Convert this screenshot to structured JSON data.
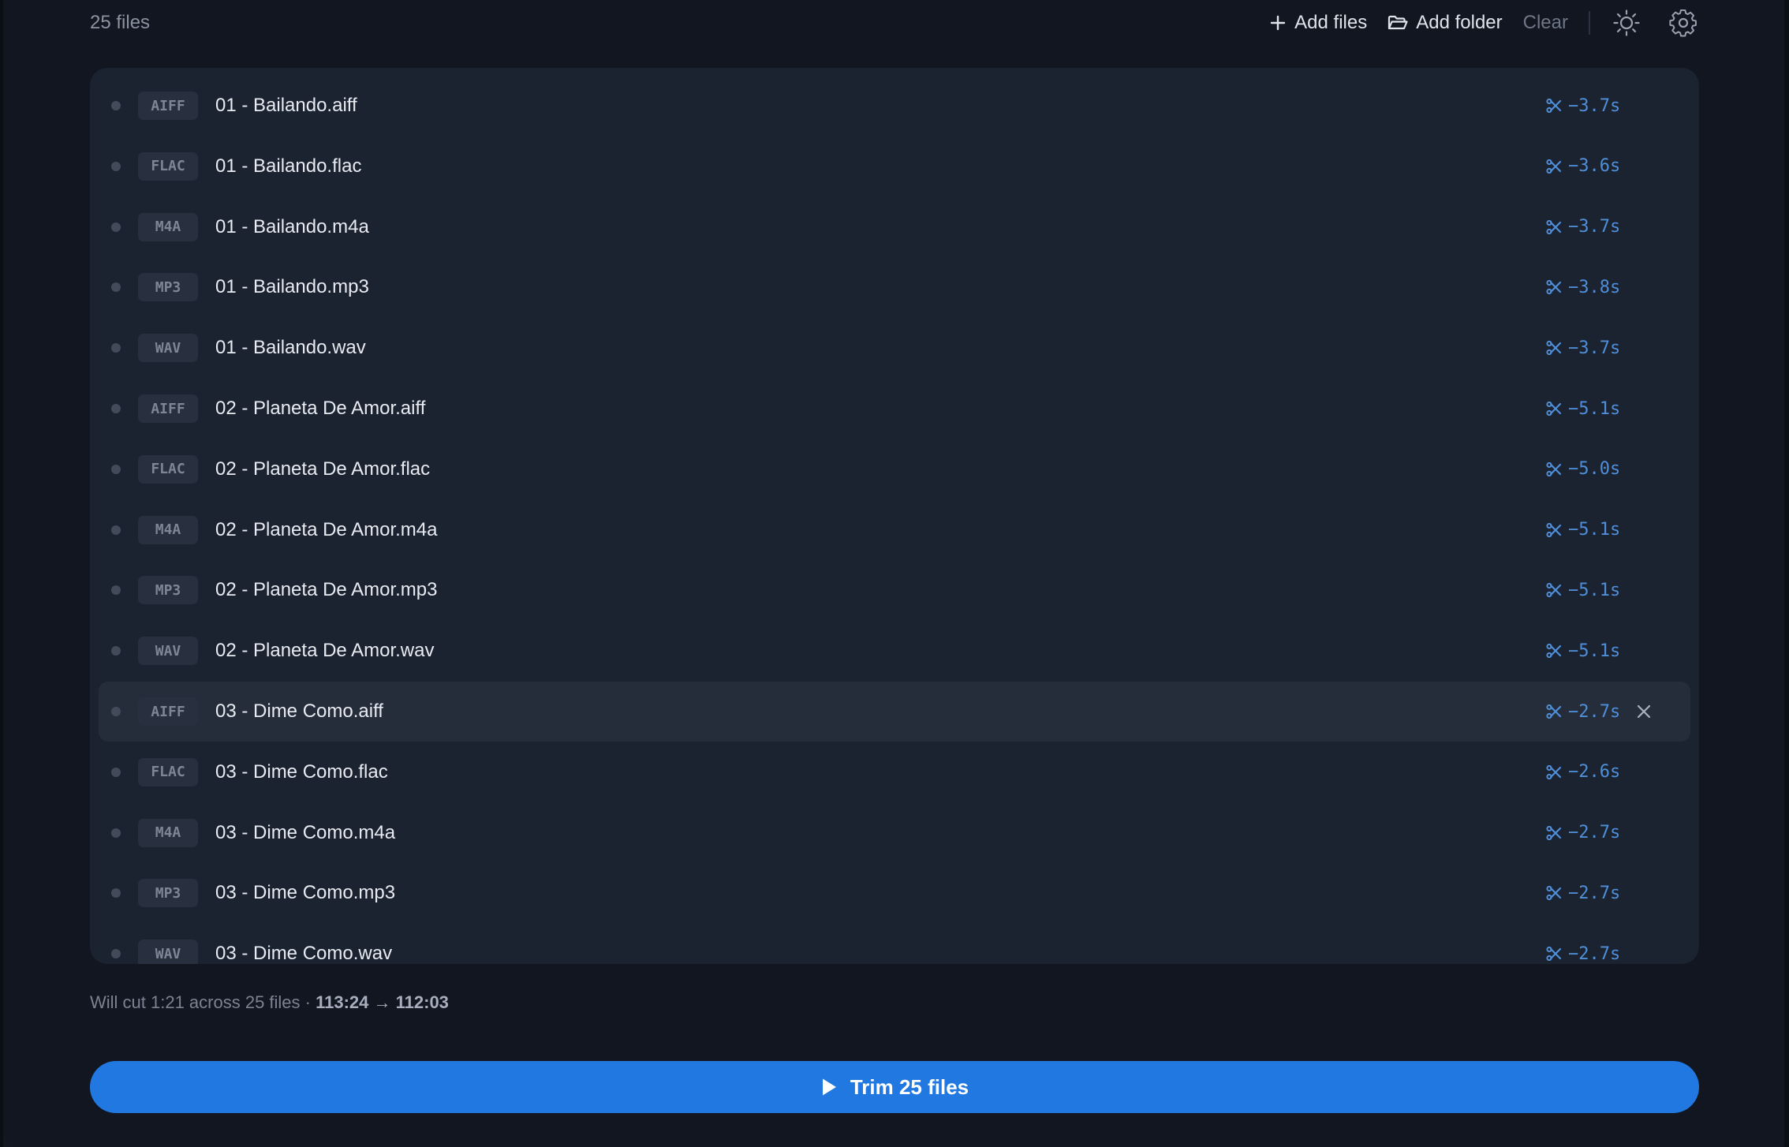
{
  "header": {
    "file_count": "25 files",
    "add_files": "Add files",
    "add_folder": "Add folder",
    "clear": "Clear",
    "theme_icon": "sun-icon",
    "settings_icon": "gear-icon"
  },
  "files": [
    {
      "format": "AIFF",
      "name": "01 - Bailando.aiff",
      "trim": "−3.7s"
    },
    {
      "format": "FLAC",
      "name": "01 - Bailando.flac",
      "trim": "−3.6s"
    },
    {
      "format": "M4A",
      "name": "01 - Bailando.m4a",
      "trim": "−3.7s"
    },
    {
      "format": "MP3",
      "name": "01 - Bailando.mp3",
      "trim": "−3.8s"
    },
    {
      "format": "WAV",
      "name": "01 - Bailando.wav",
      "trim": "−3.7s"
    },
    {
      "format": "AIFF",
      "name": "02 - Planeta De Amor.aiff",
      "trim": "−5.1s"
    },
    {
      "format": "FLAC",
      "name": "02 - Planeta De Amor.flac",
      "trim": "−5.0s"
    },
    {
      "format": "M4A",
      "name": "02 - Planeta De Amor.m4a",
      "trim": "−5.1s"
    },
    {
      "format": "MP3",
      "name": "02 - Planeta De Amor.mp3",
      "trim": "−5.1s"
    },
    {
      "format": "WAV",
      "name": "02 - Planeta De Amor.wav",
      "trim": "−5.1s"
    },
    {
      "format": "AIFF",
      "name": "03 - Dime Como.aiff",
      "trim": "−2.7s"
    },
    {
      "format": "FLAC",
      "name": "03 - Dime Como.flac",
      "trim": "−2.6s"
    },
    {
      "format": "M4A",
      "name": "03 - Dime Como.m4a",
      "trim": "−2.7s"
    },
    {
      "format": "MP3",
      "name": "03 - Dime Como.mp3",
      "trim": "−2.7s"
    },
    {
      "format": "WAV",
      "name": "03 - Dime Como.wav",
      "trim": "−2.7s"
    }
  ],
  "hovered_file_index": 10,
  "summary": {
    "prefix": "Will cut 1:21 across 25 files · ",
    "durations": "113:24 → 112:03"
  },
  "action": {
    "label": "Trim 25 files"
  },
  "colors": {
    "accent": "#2178e0",
    "trim_text": "#4f8fd9",
    "background": "#111621",
    "panel": "#1b2230"
  }
}
